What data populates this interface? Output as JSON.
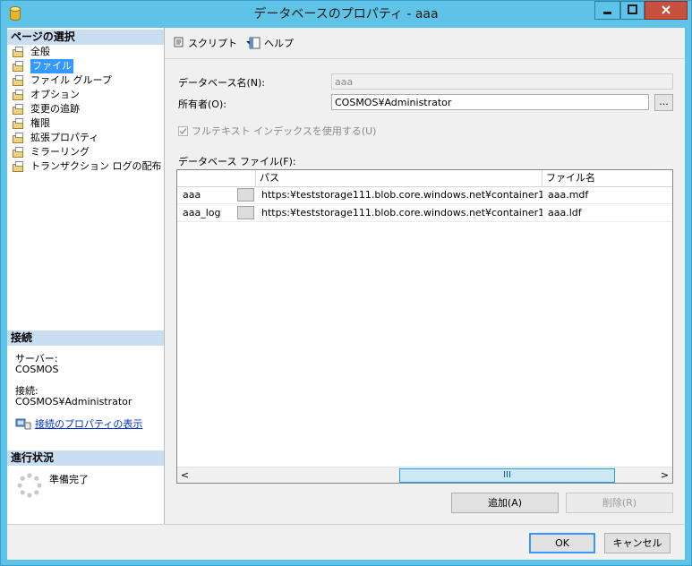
{
  "window": {
    "title": "データベースのプロパティ - aaa"
  },
  "left_pane": {
    "select_page_header": "ページの選択",
    "pages": [
      {
        "label": "全般",
        "selected": false
      },
      {
        "label": "ファイル",
        "selected": true
      },
      {
        "label": "ファイル グループ",
        "selected": false
      },
      {
        "label": "オプション",
        "selected": false
      },
      {
        "label": "変更の追跡",
        "selected": false
      },
      {
        "label": "権限",
        "selected": false
      },
      {
        "label": "拡張プロパティ",
        "selected": false
      },
      {
        "label": "ミラーリング",
        "selected": false
      },
      {
        "label": "トランザクション ログの配布",
        "selected": false
      }
    ],
    "connection_header": "接続",
    "server_label": "サーバー:",
    "server_value": "COSMOS",
    "connection_label": "接続:",
    "connection_value": "COSMOS¥Administrator",
    "view_connection_link": "接続のプロパティの表示",
    "progress_header": "進行状況",
    "progress_status": "準備完了"
  },
  "toolbar": {
    "script_label": "スクリプト",
    "help_label": "ヘルプ"
  },
  "form": {
    "db_name_label": "データベース名(N):",
    "db_name_value": "aaa",
    "owner_label": "所有者(O):",
    "owner_value": "COSMOS¥Administrator",
    "browse_label": "...",
    "fulltext_label": "フルテキスト インデックスを使用する(U)",
    "fulltext_checked": true,
    "db_files_label": "データベース ファイル(F):"
  },
  "grid": {
    "columns": [
      "パス",
      "ファイル名"
    ],
    "rows": [
      {
        "logical": "aaa",
        "path": "https:¥teststorage111.blob.core.windows.net¥container1",
        "file": "aaa.mdf"
      },
      {
        "logical": "aaa_log",
        "path": "https:¥teststorage111.blob.core.windows.net¥container1",
        "file": "aaa.ldf"
      }
    ],
    "scroll_left": "<",
    "scroll_right": ">",
    "scroll_thumb": "III"
  },
  "buttons": {
    "add": "追加(A)",
    "remove": "削除(R)",
    "ok": "OK",
    "cancel": "キャンセル"
  },
  "colors": {
    "title_bar": "#5fc2e7",
    "selection": "#3399ff",
    "section_header": "#c9def0",
    "close_button": "#c7503f"
  }
}
